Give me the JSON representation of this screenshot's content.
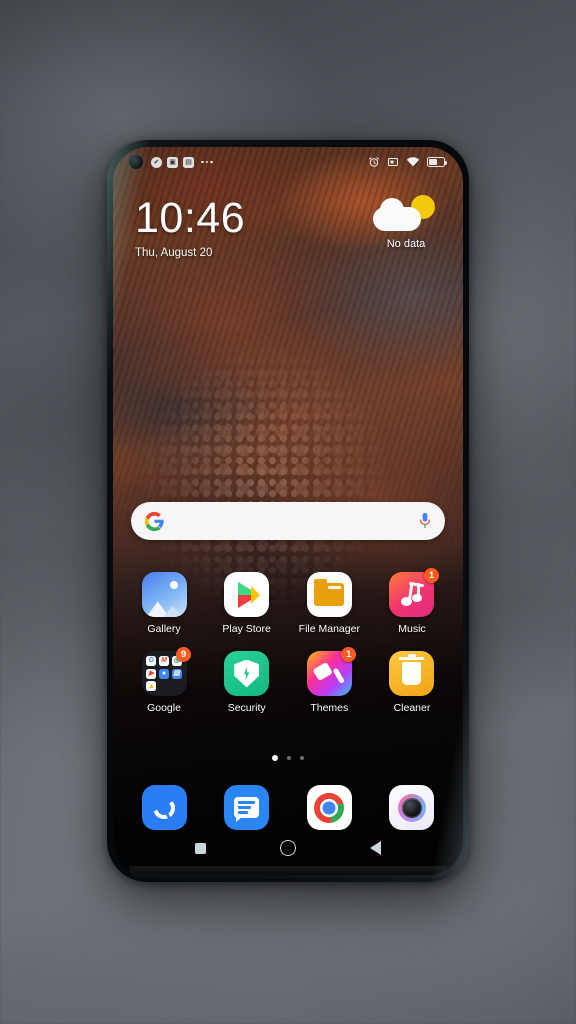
{
  "device": {
    "type": "smartphone",
    "screen": "android-home-screen"
  },
  "status_bar": {
    "notifications": [
      {
        "name": "check-notification-icon",
        "glyph": "✔"
      },
      {
        "name": "app-notification-icon",
        "glyph": "▣"
      },
      {
        "name": "message-notification-icon",
        "glyph": "▤"
      }
    ],
    "overflow": "...",
    "right_icons": [
      {
        "name": "alarm-icon"
      },
      {
        "name": "screenshot-icon"
      },
      {
        "name": "wifi-icon"
      },
      {
        "name": "battery-icon"
      }
    ]
  },
  "clock_widget": {
    "time": "10:46",
    "date": "Thu, August 20"
  },
  "weather_widget": {
    "status": "No data",
    "condition": "partly-cloudy"
  },
  "search": {
    "placeholder": "",
    "value": "",
    "logo": "google-g-logo",
    "mic": "microphone-icon"
  },
  "apps": {
    "rows": [
      [
        {
          "label": "Gallery",
          "icon": "gallery-icon",
          "badge": ""
        },
        {
          "label": "Play Store",
          "icon": "play-store-icon",
          "badge": ""
        },
        {
          "label": "File Manager",
          "icon": "file-manager-icon",
          "badge": ""
        },
        {
          "label": "Music",
          "icon": "music-icon",
          "badge": "1"
        }
      ],
      [
        {
          "label": "Google",
          "icon": "google-folder-icon",
          "badge": "9"
        },
        {
          "label": "Security",
          "icon": "security-icon",
          "badge": ""
        },
        {
          "label": "Themes",
          "icon": "themes-icon",
          "badge": "1"
        },
        {
          "label": "Cleaner",
          "icon": "cleaner-icon",
          "badge": ""
        }
      ]
    ],
    "google_folder_minis": [
      "G",
      "M",
      "◎",
      "▶",
      "●",
      "▤",
      "▲"
    ]
  },
  "page_indicator": {
    "total": 3,
    "active": 1
  },
  "dock": [
    {
      "label": "Phone",
      "icon": "phone-icon"
    },
    {
      "label": "Messages",
      "icon": "messages-icon"
    },
    {
      "label": "Chrome",
      "icon": "chrome-icon"
    },
    {
      "label": "Camera",
      "icon": "camera-icon"
    }
  ],
  "nav_bar": [
    {
      "name": "recents-button"
    },
    {
      "name": "home-button"
    },
    {
      "name": "back-button"
    }
  ],
  "colors": {
    "badge": "#ff5a1f",
    "search_bg": "#f6f6f6",
    "accent_blue": "#2a7df4"
  }
}
